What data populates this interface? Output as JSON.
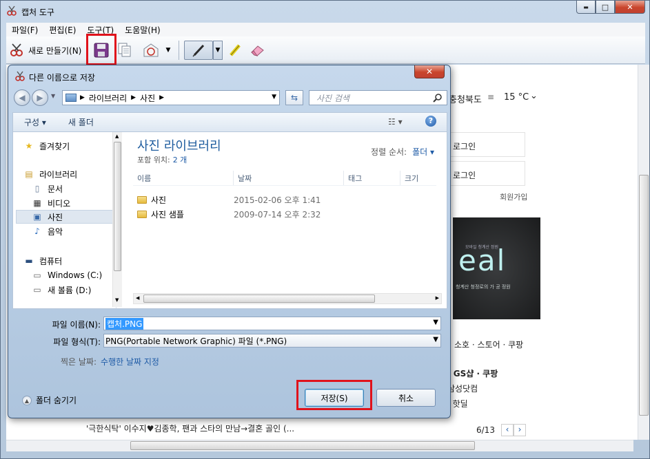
{
  "window": {
    "title": "캡처 도구",
    "controls": {
      "minimize": "▬",
      "maximize": "□",
      "close": "✕"
    }
  },
  "menubar": {
    "items": [
      "파일(F)",
      "편집(E)",
      "도구(T)",
      "도움말(H)"
    ]
  },
  "toolbar": {
    "new_snip_label": "새로 만들기(N)"
  },
  "background_page": {
    "weather_region": "충청북도",
    "weather_temp": "15 °C",
    "login_1": "로그인",
    "login_2": "로그인",
    "signup": "회원가입",
    "banner_headline": "eal",
    "banner_small_top": "모바일 청계산 정원",
    "banner_small_bottom": "청계산 청정로의 가 공 정원",
    "tabs_row": "소호 · 스토어 · 쿠팡",
    "links_row_1": "· GS샵 · 쿠팡",
    "links_row_2": "삼성닷컴",
    "links_row_3": "· 핫딜",
    "news_line": "'극한식탁' 이수지♥김종학, 팬과 스타의 만남→결혼 골인 (...",
    "pager": "6/13"
  },
  "save_dialog": {
    "title": "다른 이름으로 저장",
    "close_label": "✕",
    "breadcrumb": [
      "라이브러리",
      "사진"
    ],
    "search_placeholder": "사진 검색",
    "command_bar": {
      "organize": "구성 ▾",
      "new_folder": "새 폴더"
    },
    "nav_pane": {
      "favorites": "즐겨찾기",
      "libraries": "라이브러리",
      "documents": "문서",
      "videos": "비디오",
      "pictures": "사진",
      "music": "음악",
      "computer": "컴퓨터",
      "drive_c": "Windows  (C:)",
      "drive_d": "새 볼륨 (D:)"
    },
    "library_title": "사진 라이브러리",
    "includes_label": "포함 위치:",
    "includes_value": "2 개",
    "sort_label": "정렬 순서:",
    "sort_value": "폴더 ▾",
    "columns": [
      "이름",
      "날짜",
      "태그",
      "크기"
    ],
    "files": [
      {
        "name": "사진",
        "date": "2015-02-06 오후 1:41"
      },
      {
        "name": "사진 샘플",
        "date": "2009-07-14 오후 2:32"
      }
    ],
    "filename_label": "파일 이름(N):",
    "filename_value": "캡처.PNG",
    "filetype_label": "파일 형식(T):",
    "filetype_value": "PNG(Portable Network Graphic) 파일 (*.PNG)",
    "taken_date_label": "찍은 날짜:",
    "taken_date_value": "수행한 날짜 지정",
    "hide_folders": "폴더 숨기기",
    "save_button": "저장(S)",
    "cancel_button": "취소"
  },
  "colors": {
    "highlight_outline": "#e0121b",
    "link": "#1e5ba6",
    "library_title": "#1e5c9e"
  }
}
